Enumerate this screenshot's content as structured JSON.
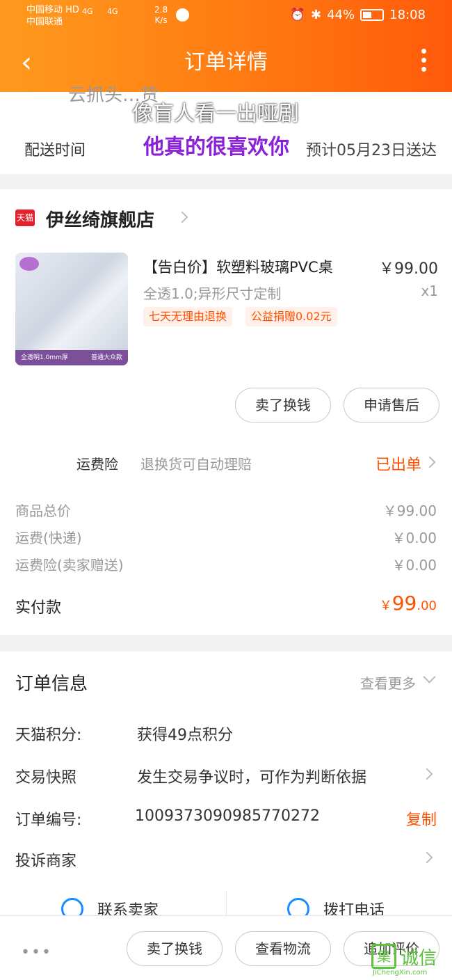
{
  "status_bar": {
    "carrier_line1": "中国移动 HD",
    "carrier_line2": "中国联通",
    "signal1": "4G",
    "signal2": "4G",
    "speed_value": "2.8",
    "speed_unit": "K/s",
    "battery": "44%",
    "time": "18:08"
  },
  "header": {
    "title": "订单详情",
    "back_icon": "chevron-left-icon",
    "more_icon": "more-vertical-icon"
  },
  "delivery": {
    "partial_text": "云抓头…货",
    "label": "配送时间",
    "value": "预计05月23日送达"
  },
  "overlay": {
    "line1": "像盲人看一出哑剧",
    "line2": "他真的很喜欢你"
  },
  "store": {
    "badge": "天猫",
    "name": "伊丝绮旗舰店"
  },
  "product": {
    "title": "【告白价】软塑料玻璃PVC桌",
    "spec": "全透1.0;异形尺寸定制",
    "price": "￥99.00",
    "quantity": "x1",
    "tags": [
      "七天无理由退换",
      "公益捐赠0.02元"
    ],
    "thumb_left_text": "全透明1.0mm厚",
    "thumb_right_text": "普通大众款"
  },
  "item_actions": {
    "sell": "卖了换钱",
    "after_sale": "申请售后"
  },
  "insurance": {
    "label": "运费险",
    "desc": "退换货可自动理赔",
    "status": "已出单"
  },
  "summary": {
    "rows": [
      {
        "label": "商品总价",
        "value": "￥99.00"
      },
      {
        "label": "运费(快递)",
        "value": "￥0.00"
      },
      {
        "label": "运费险(卖家赠送)",
        "value": "￥0.00"
      }
    ],
    "paid_label": "实付款",
    "paid_currency": "￥",
    "paid_int": "99",
    "paid_dec": ".00"
  },
  "order_info": {
    "title": "订单信息",
    "more": "查看更多",
    "points_label": "天猫积分:",
    "points_value": "获得49点积分",
    "snapshot_label": "交易快照",
    "snapshot_value": "发生交易争议时，可作为判断依据",
    "order_no_label": "订单编号:",
    "order_no_value": "1009373090985770272",
    "copy": "复制",
    "complaint": "投诉商家",
    "contact_seller": "联系卖家",
    "call_phone": "拨打电话"
  },
  "bottom_bar": {
    "sell": "卖了换钱",
    "logistics": "查看物流",
    "review": "追加评价",
    "more": "•••"
  },
  "watermark": {
    "mark": "集",
    "text": "诚信",
    "sub": "JiChengXin.com"
  },
  "colors": {
    "accent": "#ff5000",
    "header_start": "#ff9a1e",
    "header_end": "#ff5a0a"
  }
}
